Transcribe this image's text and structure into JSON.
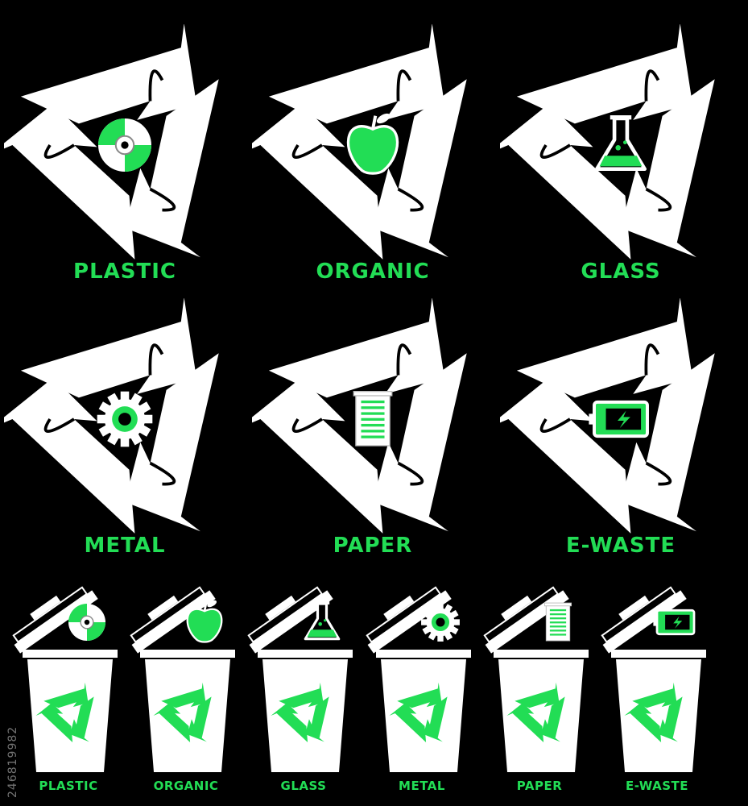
{
  "colors": {
    "accent": "#22dd55",
    "background": "#000000",
    "foreground": "#ffffff"
  },
  "categories": [
    {
      "label": "PLASTIC",
      "icon": "cd-disc-icon"
    },
    {
      "label": "ORGANIC",
      "icon": "apple-icon"
    },
    {
      "label": "GLASS",
      "icon": "flask-icon"
    },
    {
      "label": "METAL",
      "icon": "gear-icon"
    },
    {
      "label": "PAPER",
      "icon": "paper-scroll-icon"
    },
    {
      "label": "E-WASTE",
      "icon": "battery-icon"
    }
  ],
  "bins": [
    {
      "label": "PLASTIC",
      "icon": "cd-disc-icon"
    },
    {
      "label": "ORGANIC",
      "icon": "apple-icon"
    },
    {
      "label": "GLASS",
      "icon": "flask-icon"
    },
    {
      "label": "METAL",
      "icon": "gear-icon"
    },
    {
      "label": "PAPER",
      "icon": "paper-scroll-icon"
    },
    {
      "label": "E-WASTE",
      "icon": "battery-icon"
    }
  ],
  "watermark": "246819982"
}
